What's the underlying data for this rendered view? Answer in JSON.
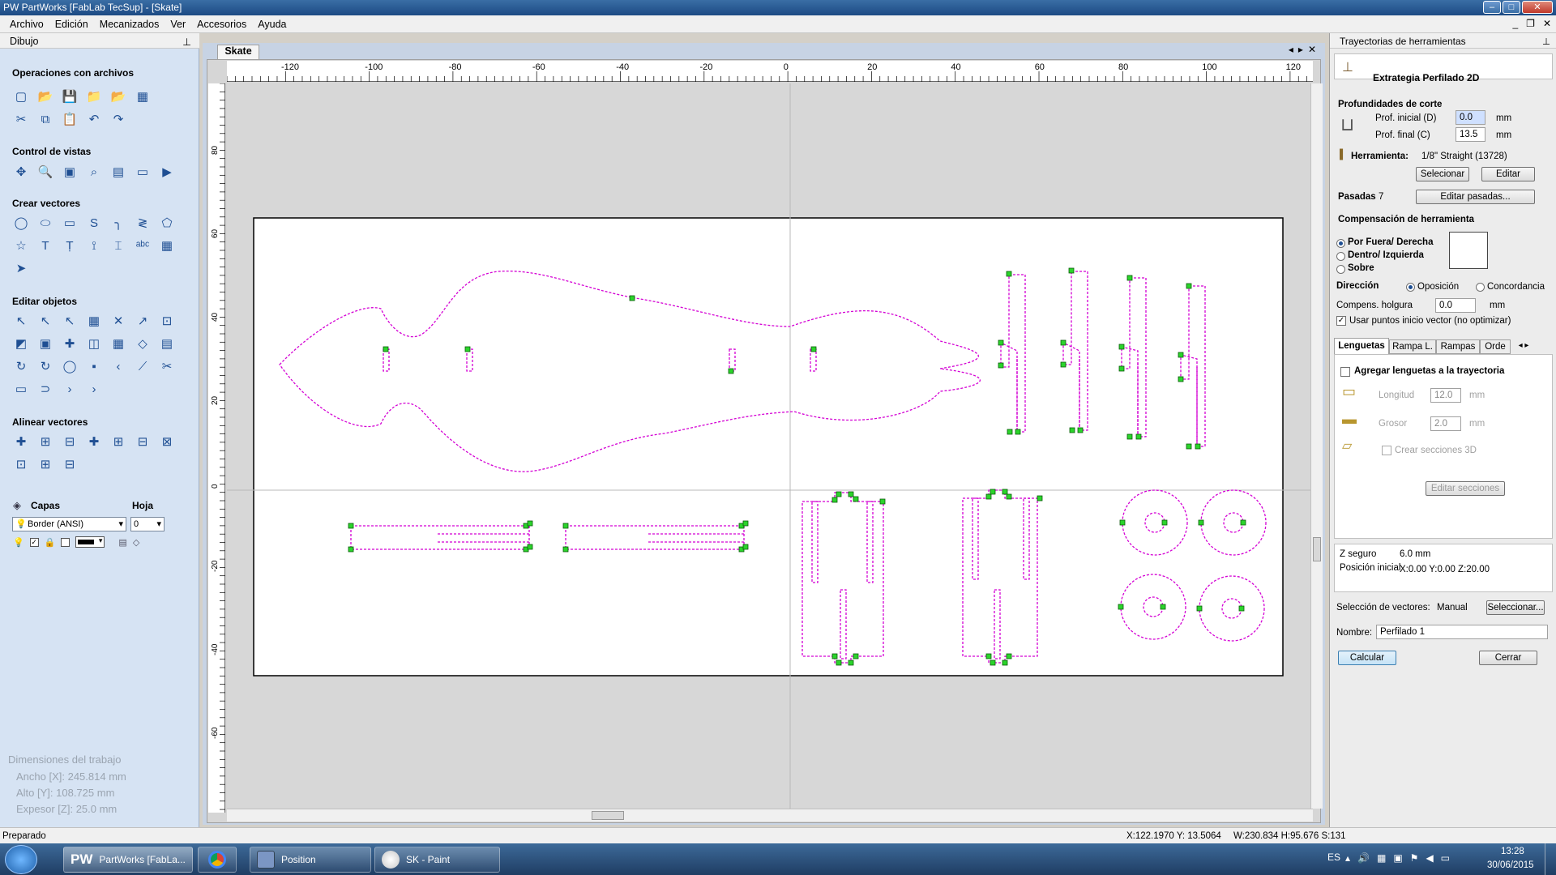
{
  "window": {
    "title": "PW  PartWorks [FabLab TecSup] - [Skate]"
  },
  "menu": [
    "Archivo",
    "Edición",
    "Mecanizados",
    "Ver",
    "Accesorios",
    "Ayuda"
  ],
  "left_panel": {
    "title": "Dibujo",
    "sections": {
      "file_ops": "Operaciones con archivos",
      "view_ctrl": "Control de vistas",
      "create_vec": "Crear vectores",
      "edit_obj": "Editar objetos",
      "align_vec": "Alinear vectores"
    },
    "layers_label": "Capas",
    "sheet_label": "Hoja",
    "layer_value": "Border (ANSI)",
    "sheet_value": "0",
    "dims_title": "Dimensiones del trabajo",
    "width": "Ancho   [X]: 245.814 mm",
    "height": "Alto    [Y]: 108.725 mm",
    "thickness": "Expesor [Z]: 25.0 mm"
  },
  "document_tab": "Skate",
  "ruler": {
    "x_labels": [
      "-120",
      "-100",
      "-80",
      "-60",
      "-40",
      "-20",
      "0",
      "20",
      "40",
      "60",
      "80",
      "100",
      "120"
    ],
    "y_labels": [
      "80",
      "60",
      "40",
      "20",
      "0",
      "-20",
      "-40",
      "-60"
    ]
  },
  "right_panel": {
    "title": "Trayectorias de herramientas",
    "strategy": "Extrategia Perfilado 2D",
    "depths_title": "Profundidades de corte",
    "start_depth_label": "Prof. inicial (D)",
    "start_depth": "0.0",
    "end_depth_label": "Prof. final (C)",
    "end_depth": "13.5",
    "unit": "mm",
    "tool_label": "Herramienta:",
    "tool_value": "1/8\" Straight (13728)",
    "select_btn": "Selecionar",
    "edit_btn": "Editar",
    "passes_label": "Pasadas",
    "passes_value": "7",
    "edit_passes_btn": "Editar pasadas...",
    "comp_title": "Compensación de herramienta",
    "comp_options": [
      "Por Fuera/ Derecha",
      "Dentro/ Izquierda",
      "Sobre"
    ],
    "direction_label": "Dirección",
    "direction_options": [
      "Oposición",
      "Concordancia"
    ],
    "clearance_label": "Compens. holgura",
    "clearance_value": "0.0",
    "use_start_points": "Usar puntos inicio vector (no optimizar)",
    "tabs": [
      "Lenguetas",
      "Rampa L.",
      "Rampas",
      "Orde"
    ],
    "add_tabs": "Agregar lenguetas a la trayectoria",
    "length_label": "Longitud",
    "length_value": "12.0",
    "thick_label": "Grosor",
    "thick_value": "2.0",
    "create_3d": "Crear secciones 3D",
    "edit_sections_btn": "Editar secciones",
    "z_safe_label": "Z seguro",
    "z_safe_value": "6.0 mm",
    "home_label": "Posición inicial",
    "home_value": "X:0.00 Y:0.00 Z:20.00",
    "vec_sel_label": "Selección de vectores:",
    "vec_sel_value": "Manual",
    "vec_sel_btn": "Seleccionar...",
    "name_label": "Nombre:",
    "name_value": "Perfilado 1",
    "calc_btn": "Calcular",
    "close_btn": "Cerrar"
  },
  "status": {
    "left": "Preparado",
    "coords": "X:122.1970 Y: 13.5064",
    "size": "W:230.834  H:95.676  S:131"
  },
  "taskbar": {
    "items": [
      "PartWorks [FabLa...",
      "",
      "Position",
      "SK - Paint"
    ],
    "lang": "ES",
    "time": "13:28",
    "date": "30/06/2015"
  }
}
